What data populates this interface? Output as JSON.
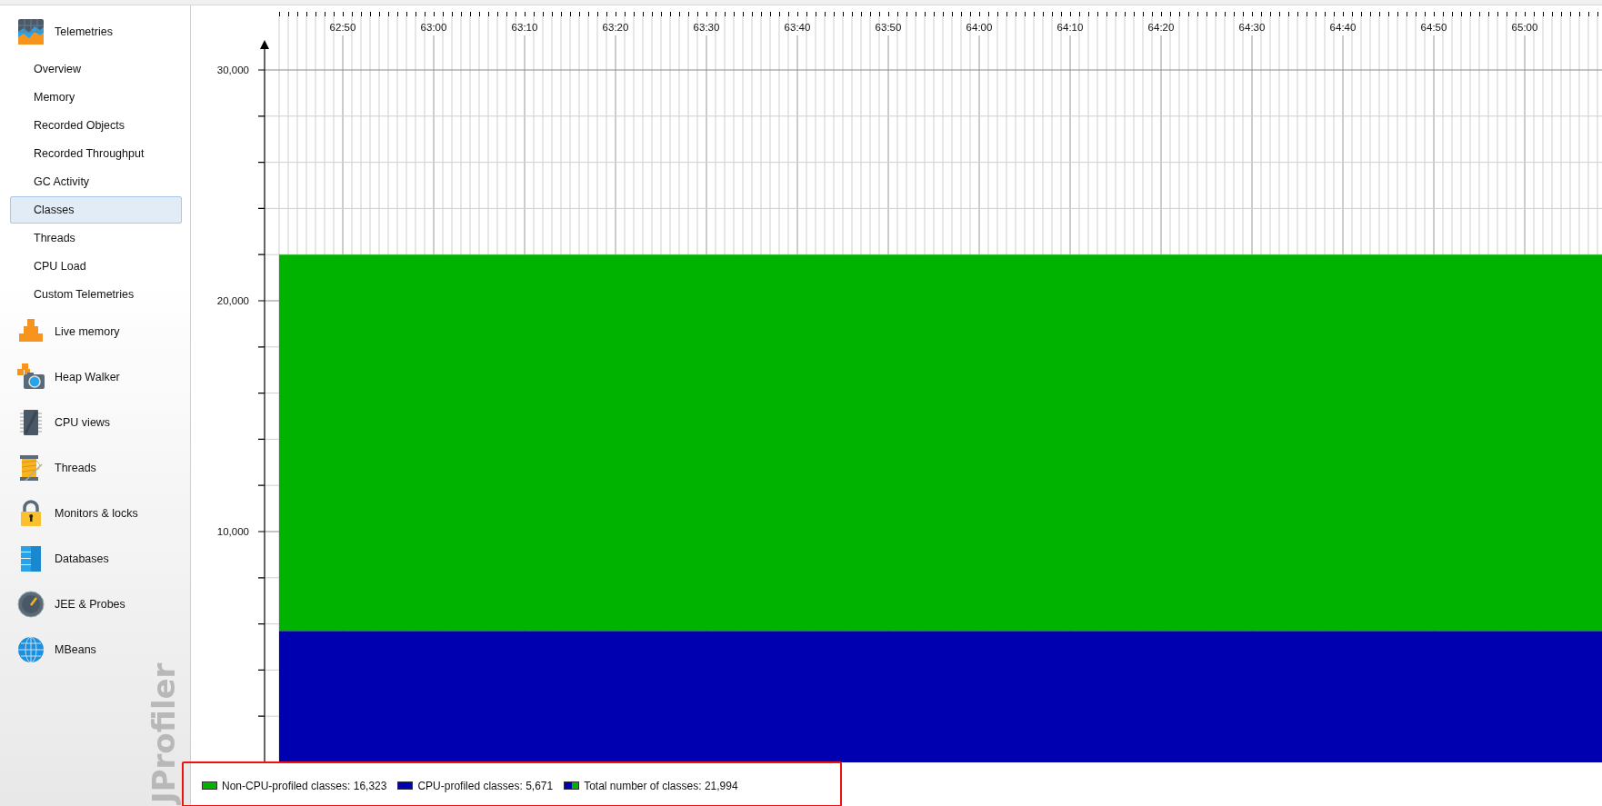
{
  "sidebar": {
    "sections": [
      {
        "label": "Telemetries",
        "children": [
          {
            "label": "Overview",
            "selected": false
          },
          {
            "label": "Memory",
            "selected": false
          },
          {
            "label": "Recorded Objects",
            "selected": false
          },
          {
            "label": "Recorded Throughput",
            "selected": false
          },
          {
            "label": "GC Activity",
            "selected": false
          },
          {
            "label": "Classes",
            "selected": true
          },
          {
            "label": "Threads",
            "selected": false
          },
          {
            "label": "CPU Load",
            "selected": false
          },
          {
            "label": "Custom Telemetries",
            "selected": false
          }
        ]
      },
      {
        "label": "Live memory"
      },
      {
        "label": "Heap Walker"
      },
      {
        "label": "CPU views"
      },
      {
        "label": "Threads"
      },
      {
        "label": "Monitors & locks"
      },
      {
        "label": "Databases"
      },
      {
        "label": "JEE & Probes"
      },
      {
        "label": "MBeans"
      }
    ],
    "brand": "JProfiler"
  },
  "chart": {
    "chart_data": {
      "type": "area",
      "stacked": true,
      "grid": true,
      "x": [
        3763,
        3908.5
      ],
      "xlim": [
        3763,
        3908.5
      ],
      "xticks": [
        {
          "value": 3770,
          "label": "62:50"
        },
        {
          "value": 3780,
          "label": "63:00"
        },
        {
          "value": 3790,
          "label": "63:10"
        },
        {
          "value": 3800,
          "label": "63:20"
        },
        {
          "value": 3810,
          "label": "63:30"
        },
        {
          "value": 3820,
          "label": "63:40"
        },
        {
          "value": 3830,
          "label": "63:50"
        },
        {
          "value": 3840,
          "label": "64:00"
        },
        {
          "value": 3850,
          "label": "64:10"
        },
        {
          "value": 3860,
          "label": "64:20"
        },
        {
          "value": 3870,
          "label": "64:30"
        },
        {
          "value": 3880,
          "label": "64:40"
        },
        {
          "value": 3890,
          "label": "64:50"
        },
        {
          "value": 3900,
          "label": "65:00"
        }
      ],
      "series": [
        {
          "name": "CPU-profiled classes:",
          "color": "#0000b0",
          "values": [
            5700,
            5700
          ]
        },
        {
          "name": "Non-CPU-profiled classes:",
          "color": "#00b300",
          "values": [
            16300,
            16300
          ]
        }
      ],
      "ylim": [
        0,
        30000
      ],
      "yticks": [
        {
          "value": 10000,
          "label": "10,000"
        },
        {
          "value": 20000,
          "label": "20,000"
        },
        {
          "value": 30000,
          "label": "30,000"
        }
      ]
    }
  },
  "legend": {
    "highlighted": true,
    "items": [
      {
        "kind": "series",
        "value": "16,323"
      },
      {
        "kind": "series",
        "value": "5,671"
      },
      {
        "kind": "stacked",
        "label": "Total number of classes:",
        "value": "21,994"
      }
    ]
  }
}
